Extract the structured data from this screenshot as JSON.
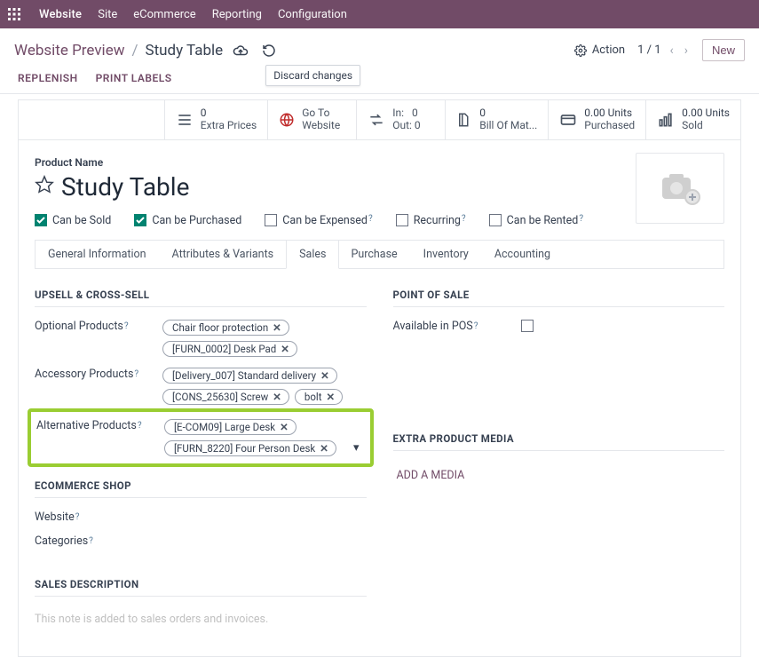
{
  "topnav": {
    "brand": "Website",
    "menus": [
      "Site",
      "eCommerce",
      "Reporting",
      "Configuration"
    ]
  },
  "breadcrumb": {
    "back": "Website Preview",
    "current": "Study Table",
    "tooltip": "Discard changes"
  },
  "action": {
    "label": "Action",
    "pager": "1 / 1",
    "new_btn": "New"
  },
  "action_links": [
    "REPLENISH",
    "PRINT LABELS"
  ],
  "stats": {
    "extra_prices": {
      "num": "0",
      "label": "Extra Prices"
    },
    "go_to": {
      "line1": "Go To",
      "line2": "Website"
    },
    "inout": {
      "in_lbl": "In:",
      "in_val": "0",
      "out_lbl": "Out:",
      "out_val": "0"
    },
    "bom": {
      "num": "0",
      "label": "Bill Of Mat..."
    },
    "purchased": {
      "num": "0.00 Units",
      "label": "Purchased"
    },
    "sold": {
      "num": "0.00 Units",
      "label": "Sold"
    }
  },
  "product": {
    "label": "Product Name",
    "title": "Study Table"
  },
  "checks": {
    "sold": {
      "label": "Can be Sold",
      "checked": true
    },
    "purchased": {
      "label": "Can be Purchased",
      "checked": true
    },
    "expensed": {
      "label": "Can be Expensed",
      "checked": false
    },
    "recurring": {
      "label": "Recurring",
      "checked": false
    },
    "rented": {
      "label": "Can be Rented",
      "checked": false
    }
  },
  "tabs": [
    "General Information",
    "Attributes & Variants",
    "Sales",
    "Purchase",
    "Inventory",
    "Accounting"
  ],
  "active_tab": "Sales",
  "sections": {
    "upsell": "UPSELL & CROSS-SELL",
    "pos": "POINT OF SALE",
    "shop": "ECOMMERCE SHOP",
    "media": "EXTRA PRODUCT MEDIA",
    "desc": "SALES DESCRIPTION"
  },
  "fields": {
    "optional": "Optional Products",
    "accessory": "Accessory Products",
    "alternative": "Alternative Products",
    "available_pos": "Available in POS",
    "website": "Website",
    "categories": "Categories"
  },
  "tags": {
    "optional": [
      "Chair floor protection",
      "[FURN_0002] Desk Pad"
    ],
    "accessory": [
      "[Delivery_007] Standard delivery",
      "[CONS_25630] Screw",
      "bolt"
    ],
    "alternative": [
      "[E-COM09] Large Desk",
      "[FURN_8220] Four Person Desk"
    ]
  },
  "media_btn": "ADD A MEDIA",
  "desc_placeholder": "This note is added to sales orders and invoices."
}
